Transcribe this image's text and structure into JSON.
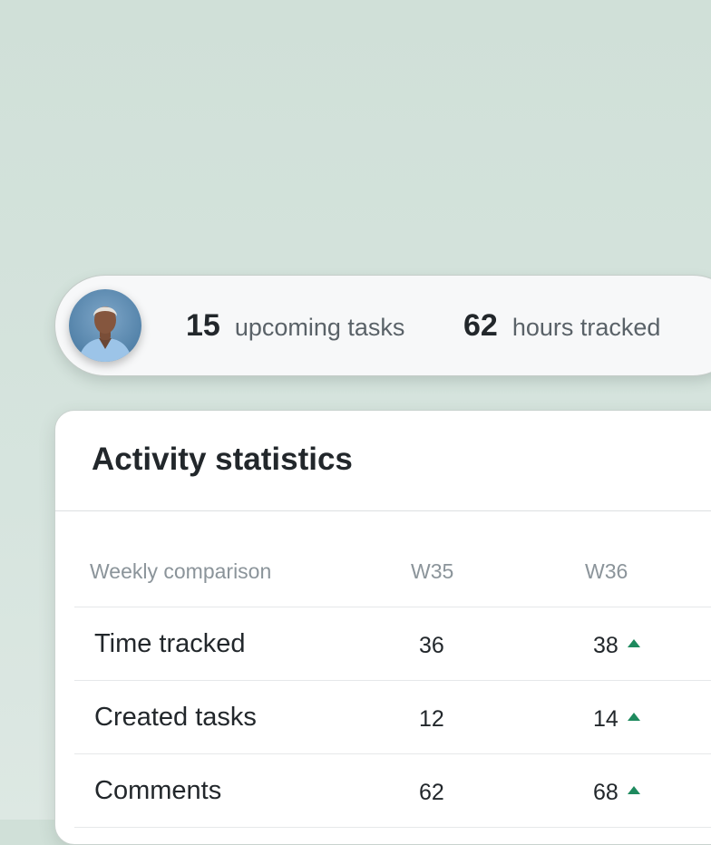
{
  "summary": {
    "upcoming_tasks": {
      "value": "15",
      "label": "upcoming tasks"
    },
    "hours_tracked": {
      "value": "62",
      "label": "hours tracked"
    },
    "avatar_icon": "user-avatar-photo"
  },
  "activity": {
    "title": "Activity statistics",
    "columns": [
      "Weekly comparison",
      "W35",
      "W36"
    ],
    "rows": [
      {
        "label": "Time tracked",
        "w35": "36",
        "w36": "38",
        "trend": "up"
      },
      {
        "label": "Created tasks",
        "w35": "12",
        "w36": "14",
        "trend": "up"
      },
      {
        "label": "Comments",
        "w35": "62",
        "w36": "68",
        "trend": "up"
      }
    ],
    "trend_color": "#1e8a5e"
  },
  "colors": {
    "background": "#d4e3dc",
    "text_primary": "#22272b",
    "text_muted": "#8b949a"
  }
}
